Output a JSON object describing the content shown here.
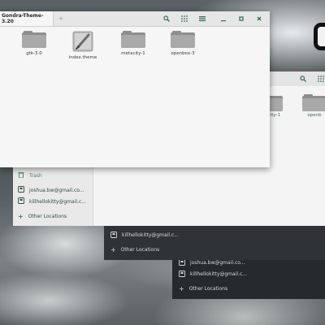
{
  "front_window": {
    "tab_title": "Gondra-Theme-3.20",
    "tab_add": "+",
    "files": [
      {
        "name": "gtk-3.0",
        "type": "folder"
      },
      {
        "name": "index.theme",
        "type": "theme-file"
      },
      {
        "name": "metacity-1",
        "type": "folder"
      },
      {
        "name": "openbox-3",
        "type": "folder"
      }
    ],
    "buttons": [
      "search-icon",
      "grid-view-icon",
      "menu-icon",
      "minimize-icon",
      "maximize-icon",
      "close-icon"
    ]
  },
  "middle_window": {
    "sidebar": [
      {
        "label": "Trash",
        "icon": "trash-icon"
      },
      {
        "label": "joshua.bw@gmail.co...",
        "icon": "account-icon"
      },
      {
        "label": "killhellokitty@gmail.c...",
        "icon": "account-icon"
      },
      {
        "label": "Other Locations",
        "icon": "plus-icon"
      }
    ],
    "files": [
      {
        "name": "etacity-1"
      },
      {
        "name": "openb"
      }
    ]
  },
  "dark_window_1": {
    "items": [
      {
        "label": "killhellokitty@gmail.c...",
        "icon": "account-icon"
      },
      {
        "label": "Other Locations",
        "icon": "plus-icon"
      }
    ]
  },
  "dark_window_2": {
    "items": [
      {
        "label": "joshua.bw@gmail.co...",
        "icon": "account-icon"
      },
      {
        "label": "killhellokitty@gmail.c...",
        "icon": "account-icon"
      },
      {
        "label": "Other Locations",
        "icon": "plus-icon"
      }
    ]
  },
  "colors": {
    "accent": "#3d6e56",
    "sidebar_text": "#2e4a3c",
    "dark_bg": "#262a2d"
  }
}
